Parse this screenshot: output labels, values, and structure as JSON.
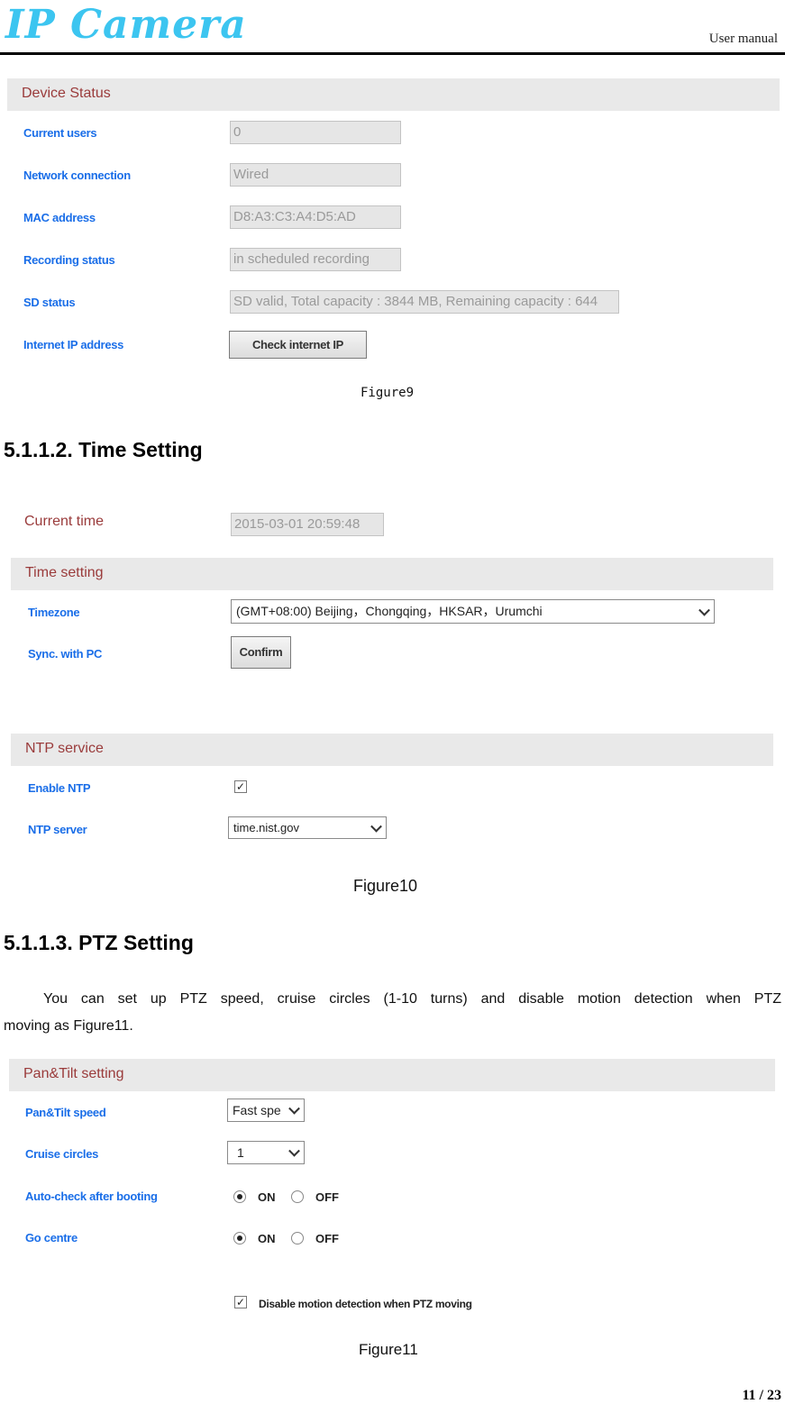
{
  "header": {
    "logo_text": "IP Camera",
    "doc_type": "User manual"
  },
  "figure9": {
    "section_title": "Device Status",
    "rows": [
      {
        "label": "Current users",
        "value": "0"
      },
      {
        "label": "Network connection",
        "value": "Wired"
      },
      {
        "label": "MAC address",
        "value": "D8:A3:C3:A4:D5:AD"
      },
      {
        "label": "Recording status",
        "value": "in scheduled recording"
      },
      {
        "label": "SD status",
        "value": "SD valid, Total capacity : 3844 MB, Remaining capacity : 644"
      }
    ],
    "internet_ip_label": "Internet IP address",
    "check_ip_button": "Check internet IP",
    "caption": "Figure9"
  },
  "section_time": {
    "heading": "5.1.1.2. Time Setting",
    "current_time_label": "Current time",
    "current_time_value": "2015-03-01 20:59:48",
    "time_setting_title": "Time setting",
    "timezone_label": "Timezone",
    "timezone_value": "(GMT+08:00) Beijing，Chongqing，HKSAR，Urumchi",
    "sync_label": "Sync. with PC",
    "confirm_button": "Confirm",
    "ntp_title": "NTP service",
    "enable_ntp_label": "Enable NTP",
    "enable_ntp_checked": true,
    "ntp_server_label": "NTP server",
    "ntp_server_value": "time.nist.gov",
    "caption": "Figure10"
  },
  "section_ptz": {
    "heading": "5.1.1.3. PTZ Setting",
    "paragraph_line1": "You can set up PTZ speed, cruise circles (1-10 turns) and disable motion detection when PTZ",
    "paragraph_line2": "moving as Figure11.",
    "panel_title": "Pan&Tilt setting",
    "speed_label": "Pan&Tilt speed",
    "speed_value": "Fast spe",
    "cruise_label": "Cruise circles",
    "cruise_value": "1",
    "autocheck_label": "Auto-check after booting",
    "autocheck_selected": "ON",
    "gocentre_label": "Go centre",
    "gocentre_selected": "ON",
    "on_label": "ON",
    "off_label": "OFF",
    "disable_motion_label": "Disable motion detection when PTZ moving",
    "disable_motion_checked": true,
    "caption": "Figure11"
  },
  "footer": {
    "page_number": "11 / 23"
  }
}
